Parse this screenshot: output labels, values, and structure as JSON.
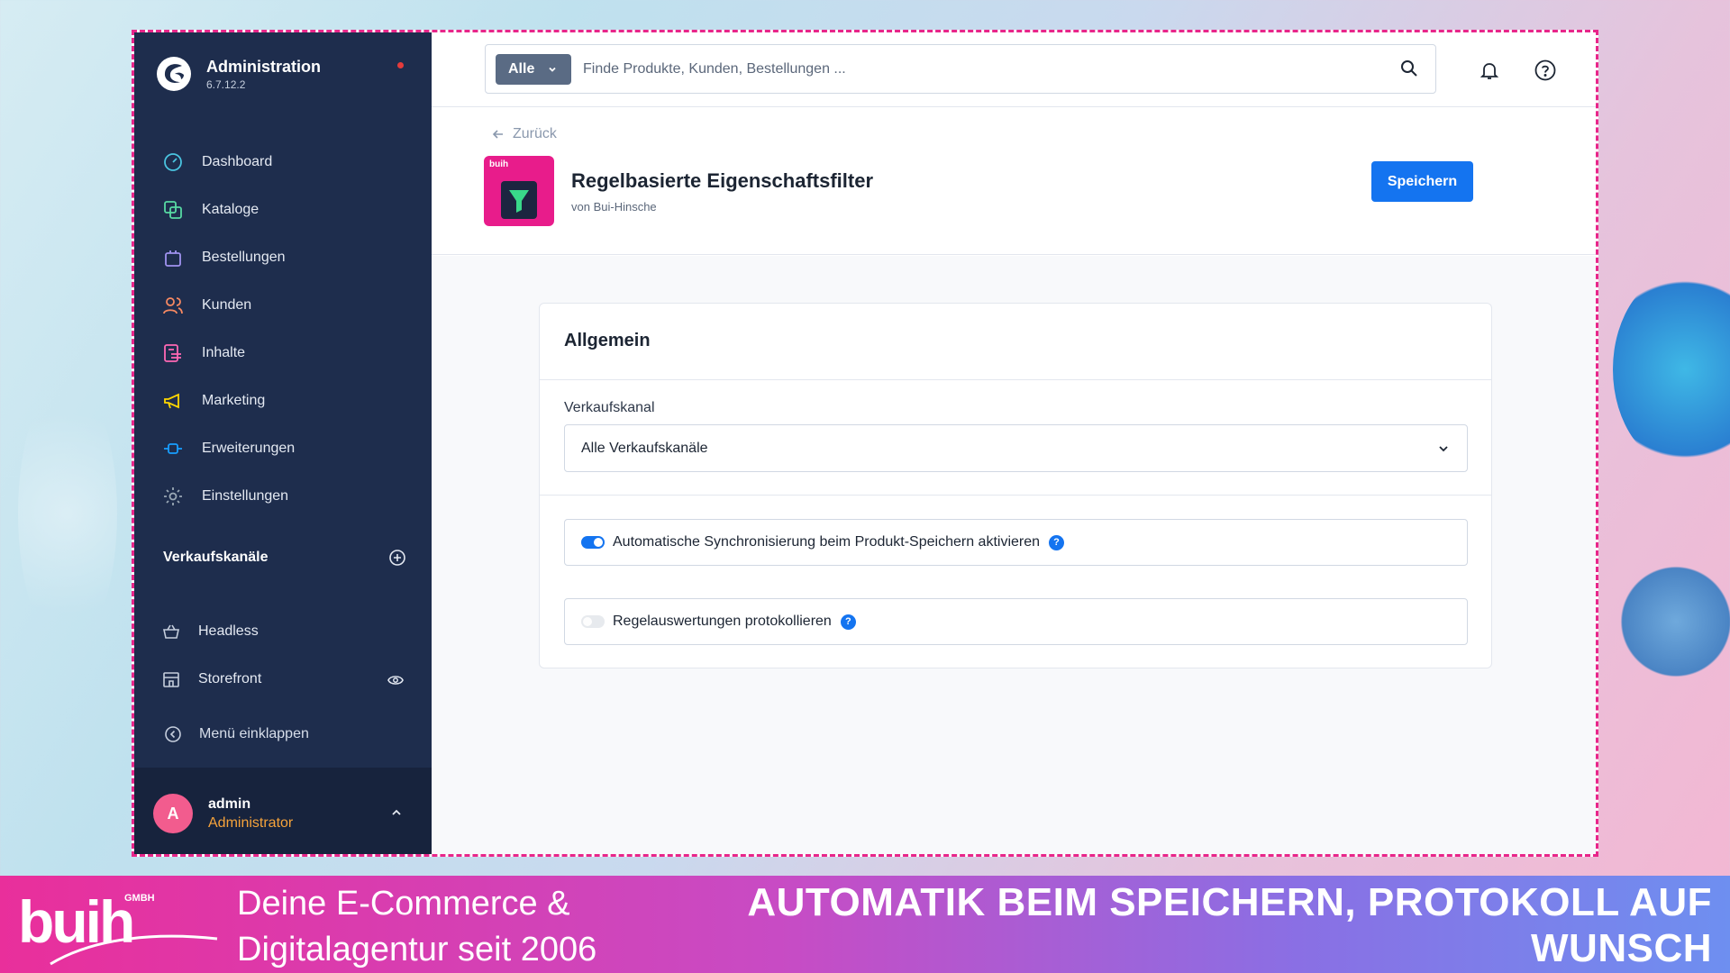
{
  "app": {
    "title": "Administration",
    "version": "6.7.12.2"
  },
  "sidebar": {
    "nav": [
      {
        "label": "Dashboard",
        "icon": "dashboard-icon",
        "color": "#4ac4e0"
      },
      {
        "label": "Kataloge",
        "icon": "catalog-icon",
        "color": "#57d9a3"
      },
      {
        "label": "Bestellungen",
        "icon": "orders-icon",
        "color": "#a092f0"
      },
      {
        "label": "Kunden",
        "icon": "customers-icon",
        "color": "#f88962"
      },
      {
        "label": "Inhalte",
        "icon": "content-icon",
        "color": "#ff68b4"
      },
      {
        "label": "Marketing",
        "icon": "marketing-icon",
        "color": "#ffd700"
      },
      {
        "label": "Erweiterungen",
        "icon": "extensions-icon",
        "color": "#189eff"
      },
      {
        "label": "Einstellungen",
        "icon": "settings-icon",
        "color": "#9aa8b5"
      }
    ],
    "sales_channels_title": "Verkaufskanäle",
    "sales_channels": [
      {
        "label": "Headless",
        "icon": "basket-icon"
      },
      {
        "label": "Storefront",
        "icon": "storefront-icon"
      }
    ],
    "collapse_label": "Menü einklappen",
    "user": {
      "initial": "A",
      "name": "admin",
      "role": "Administrator"
    }
  },
  "topbar": {
    "search_scope": "Alle",
    "search_placeholder": "Finde Produkte, Kunden, Bestellungen ..."
  },
  "header": {
    "back_label": "Zurück",
    "plugin_icon_text": "buih",
    "title": "Regelbasierte Eigenschaftsfilter",
    "author": "von Bui-Hinsche",
    "save_label": "Speichern"
  },
  "card": {
    "title": "Allgemein",
    "sales_channel_label": "Verkaufskanal",
    "sales_channel_value": "Alle Verkaufskanäle",
    "switches": [
      {
        "label": "Automatische Synchronisierung beim Produkt-Speichern aktivieren",
        "on": true
      },
      {
        "label": "Regelauswertungen protokollieren",
        "on": false
      }
    ],
    "help_glyph": "?"
  },
  "banner": {
    "logo_text": "buih",
    "logo_sub": "GMBH",
    "tagline_line1": "Deine E-Commerce &",
    "tagline_line2": "Digitalagentur seit 2006",
    "headline": "AUTOMATIK BEIM SPEICHERN, PROTOKOLL AUF WUNSCH"
  },
  "colors": {
    "accent": "#1474f0",
    "sidebar": "#1e2d4d",
    "frame": "#e8268a"
  }
}
